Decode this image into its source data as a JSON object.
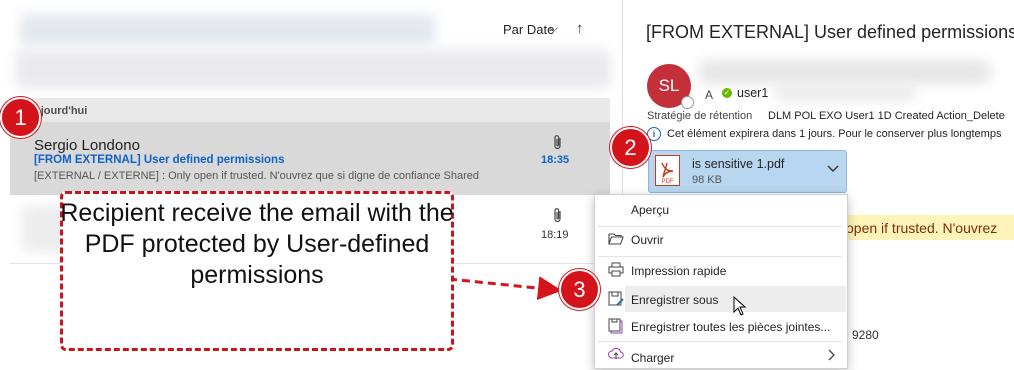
{
  "list": {
    "sort_label": "Par Date",
    "sort_chevron": "⌵",
    "sort_arrow": "↑",
    "group_label": "ujourd'hui",
    "items": [
      {
        "sender": "Sergio Londono",
        "subject": "[FROM EXTERNAL] User defined permissions",
        "preview": "[EXTERNAL / EXTERNE] : Only open if trusted. N'ouvrez que si digne de confiance   Shared",
        "time": "18:35",
        "has_attachment": true
      },
      {
        "sender": "",
        "subject": "",
        "preview": "",
        "time": "18:19",
        "has_attachment": true
      }
    ]
  },
  "reading": {
    "title": "[FROM EXTERNAL] User defined permissions",
    "avatar_initials": "SL",
    "to_label": "A",
    "recipient": "user1",
    "retention_label": "Stratégie de rétention",
    "retention_value": "DLM POL EXO User1 1D Created Action_Delete",
    "expire_text": "Cet élément expirera dans 1 jours. Pour le conserver plus longtemps",
    "attachment": {
      "name": "is sensitive 1.pdf",
      "size": "98 KB",
      "type_label": "PDF"
    },
    "banner_text": "open if trusted. N'ouvrez",
    "phone_fragment": "9 9280"
  },
  "context_menu": {
    "items": [
      {
        "label": "Aperçu",
        "icon": "",
        "submenu": false
      },
      {
        "label": "Ouvrir",
        "icon": "folder-open-icon",
        "submenu": false
      },
      {
        "label": "Impression rapide",
        "icon": "printer-icon",
        "submenu": false
      },
      {
        "label": "Enregistrer sous",
        "icon": "save-as-icon",
        "submenu": false,
        "hovered": true
      },
      {
        "label": "Enregistrer toutes les pièces jointes...",
        "icon": "save-all-icon",
        "submenu": false
      },
      {
        "label": "Charger",
        "icon": "upload-icon",
        "submenu": true
      }
    ]
  },
  "annotations": {
    "badges": [
      "1",
      "2",
      "3"
    ],
    "callout": "Recipient receive the email with the PDF protected by User-defined permissions",
    "color": "#d4131b"
  }
}
